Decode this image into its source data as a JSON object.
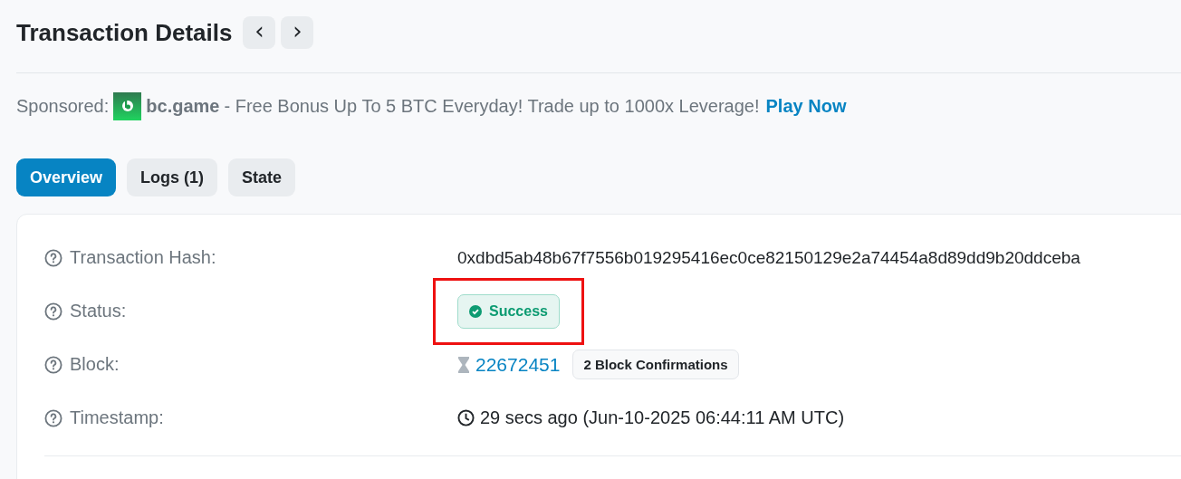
{
  "header": {
    "title": "Transaction Details",
    "nav_buttons": [
      "‹",
      "›"
    ]
  },
  "sponsor": {
    "label": "Sponsored:",
    "brand": "bc.game",
    "message": "- Free Bonus Up To 5 BTC Everyday! Trade up to 1000x Leverage!",
    "link": "Play Now"
  },
  "tabs": [
    {
      "label": "Overview",
      "selected": true
    },
    {
      "label": "Logs (1)",
      "selected": false
    },
    {
      "label": "State",
      "selected": false
    }
  ],
  "rows": [
    {
      "label": "Transaction Hash:",
      "kind": "text",
      "value": "0xdbd5ab48b67f7556b019295416ec0ce82150129e2a74454a8d89dd9b20ddceba",
      "highlighted": false
    },
    {
      "label": "Status:",
      "kind": "status",
      "value": "Success",
      "highlighted": true
    },
    {
      "label": "Block:",
      "kind": "block",
      "value": "22672451",
      "badge": "2 Block Confirmations",
      "highlighted": false
    },
    {
      "label": "Timestamp:",
      "kind": "time",
      "value": "29 secs ago (Jun-10-2025 06:44:11 AM UTC)",
      "highlighted": false
    }
  ]
}
